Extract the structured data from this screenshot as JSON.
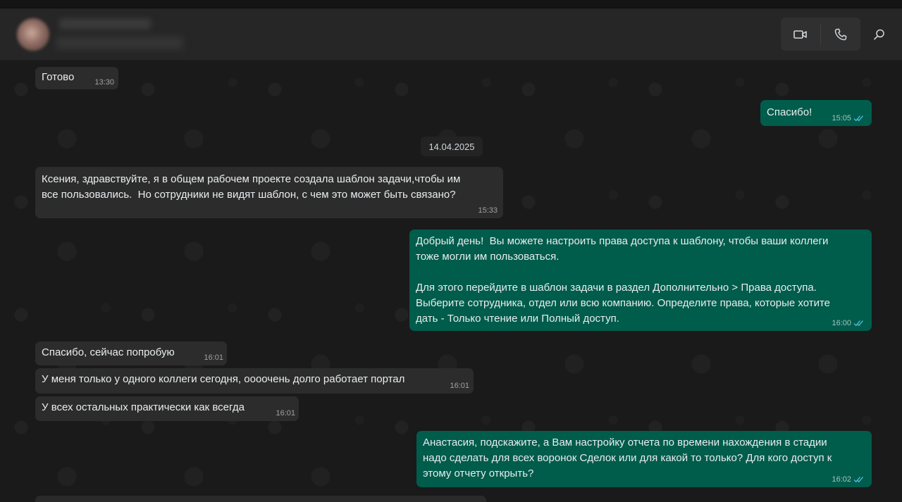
{
  "header": {
    "contact_name": "",
    "contact_status": "",
    "icons": {
      "video": "video-camera-icon",
      "voice": "phone-icon",
      "search": "search-icon"
    }
  },
  "colors": {
    "incoming_bubble": "#2c2c2c",
    "outgoing_bubble": "#005c4b",
    "tick": "#53bdeb"
  },
  "chat": {
    "date_separator": "14.04.2025",
    "messages": [
      {
        "dir": "in",
        "text": "Готово",
        "time": "13:30"
      },
      {
        "dir": "out",
        "text": "Спасибо!",
        "time": "15:05"
      },
      {
        "dir": "in",
        "text": "Ксения, здравствуйте, я в общем рабочем проекте создала шаблон задачи,чтобы им\nвсе пользовались.  Но сотрудники не видят шаблон, с чем это может быть связано?",
        "time": "15:33"
      },
      {
        "dir": "out",
        "text": "Добрый день!  Вы можете настроить права доступа к шаблону, чтобы ваши коллеги\nтоже могли им пользоваться.\n\nДля этого перейдите в шаблон задачи в раздел Дополнительно > Права доступа.\nВыберите сотрудника, отдел или всю компанию. Определите права, которые хотите\nдать - Только чтение или Полный доступ.",
        "time": "16:00"
      },
      {
        "dir": "in",
        "text": "Спасибо, сейчас попробую",
        "time": "16:01"
      },
      {
        "dir": "in",
        "text": "У меня только у одного коллеги сегодня, оооочень долго работает портал",
        "time": "16:01"
      },
      {
        "dir": "in",
        "text": "У всех остальных практически как всегда",
        "time": "16:01"
      },
      {
        "dir": "out",
        "text": "Анастасия, подскажите, а Вам настройку отчета по времени нахождения в стадии\nнадо сделать для всех воронок Сделок или для какой то только? Для кого доступ к\nэтому отчету открыть?",
        "time": "16:02"
      }
    ]
  }
}
